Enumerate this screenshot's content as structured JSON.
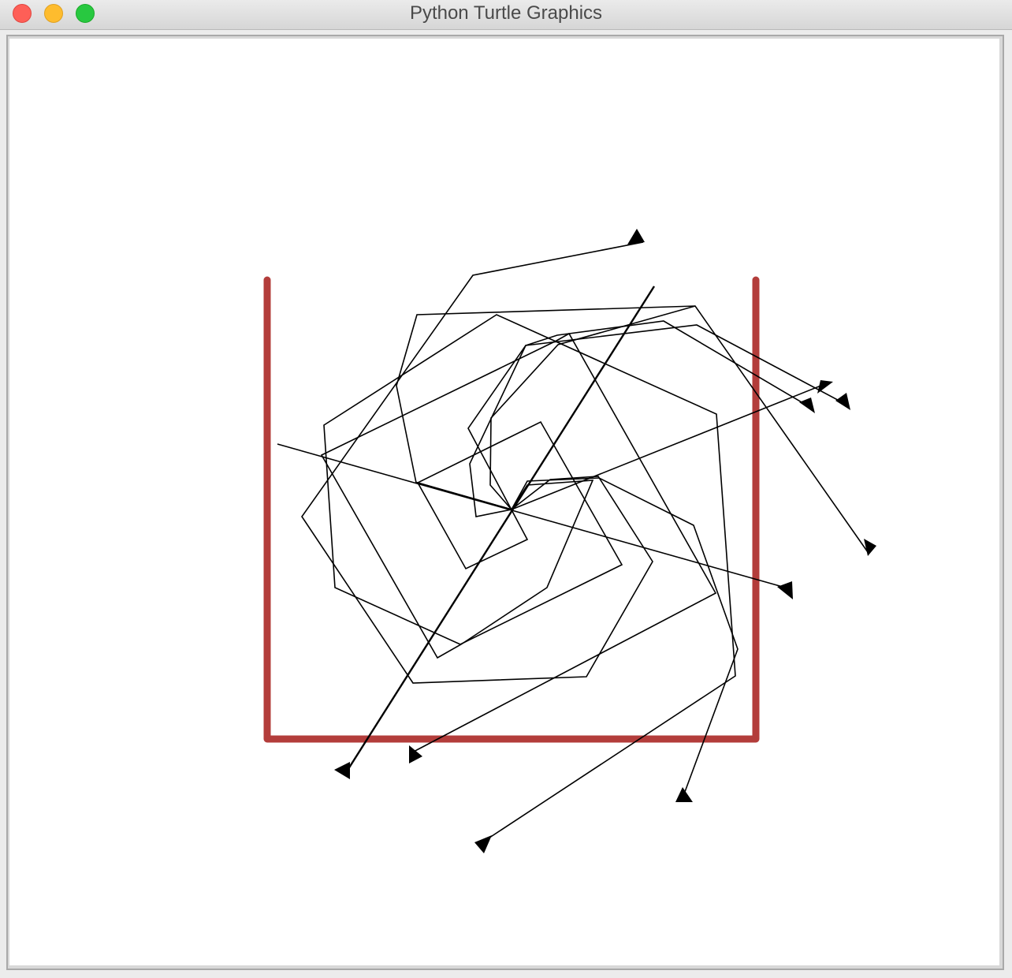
{
  "window": {
    "title": "Python Turtle Graphics"
  },
  "colors": {
    "titlebar": "#e3e3e3",
    "canvas": "#ffffff",
    "box": "#b33d3b",
    "ink": "#000000"
  },
  "icons": {
    "close": "traffic-light-red",
    "minimize": "traffic-light-yellow",
    "zoom": "traffic-light-green",
    "turtle": "classic-arrow"
  }
}
